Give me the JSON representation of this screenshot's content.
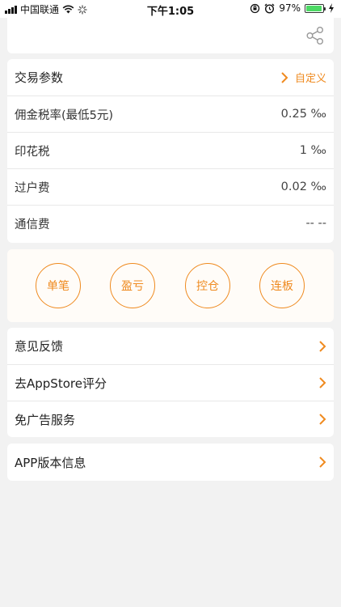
{
  "status_bar": {
    "carrier": "中国联通",
    "time": "下午1:05",
    "battery": "97%",
    "battery_level": 0.97,
    "icons": [
      "signal-icon",
      "wifi-icon",
      "loading-icon",
      "orientation-lock-icon",
      "alarm-icon",
      "battery-icon",
      "charging-icon"
    ]
  },
  "top_card": {
    "icon": "share-icon"
  },
  "trade_params": {
    "title": "交易参数",
    "custom_label": "自定义",
    "rows": [
      {
        "label": "佣金税率(最低5元)",
        "value": "0.25 ‰"
      },
      {
        "label": "印花税",
        "value": "1 ‰"
      },
      {
        "label": "过户费",
        "value": "0.02 ‰"
      },
      {
        "label": "通信费",
        "value": "-- --"
      }
    ]
  },
  "tools": [
    {
      "label": "单笔"
    },
    {
      "label": "盈亏"
    },
    {
      "label": "控仓"
    },
    {
      "label": "连板"
    }
  ],
  "menu": [
    {
      "label": "意见反馈"
    },
    {
      "label": "去AppStore评分"
    },
    {
      "label": "免广告服务"
    }
  ],
  "version": {
    "label": "APP版本信息"
  },
  "colors": {
    "accent": "#ef8a1f",
    "background": "#f2f2f2",
    "card": "#ffffff",
    "battery": "#4cd964"
  }
}
